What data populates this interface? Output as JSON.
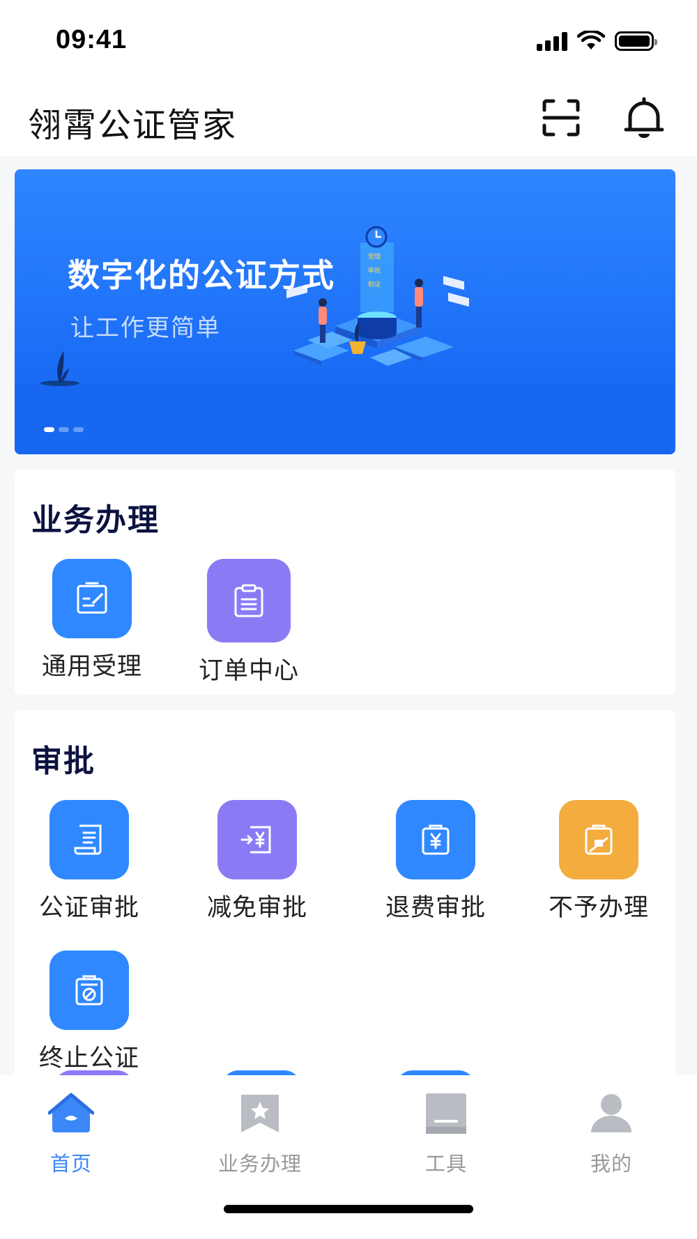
{
  "status_bar": {
    "time": "09:41"
  },
  "header": {
    "title": "翎霄公证管家"
  },
  "banner": {
    "title": "数字化的公证方式",
    "subtitle": "让工作更简单",
    "illustration_labels": [
      "受理",
      "审批",
      "制证"
    ],
    "slide_count": 3,
    "active_slide": 1
  },
  "business": {
    "title": "业务办理",
    "items": [
      {
        "label": "通用受理",
        "icon": "edit-document-icon",
        "color": "#2f88ff"
      },
      {
        "label": "订单中心",
        "icon": "clipboard-list-icon",
        "color": "#8a7bf5"
      }
    ]
  },
  "approval": {
    "title": "审批",
    "items": [
      {
        "label": "公证审批",
        "icon": "scroll-document-icon",
        "color": "#2f88ff"
      },
      {
        "label": "减免审批",
        "icon": "yuan-transfer-icon",
        "color": "#8a7bf5"
      },
      {
        "label": "退费审批",
        "icon": "yuan-bag-icon",
        "color": "#2f88ff"
      },
      {
        "label": "不予办理",
        "icon": "reject-clipboard-icon",
        "color": "#f4ac3e"
      },
      {
        "label": "终止公证",
        "icon": "forbidden-clipboard-icon",
        "color": "#2f88ff"
      }
    ]
  },
  "tab_bar": {
    "tabs": [
      {
        "label": "首页",
        "icon": "home-icon",
        "active": true
      },
      {
        "label": "业务办理",
        "icon": "star-bookmark-icon",
        "active": false
      },
      {
        "label": "工具",
        "icon": "toolbox-icon",
        "active": false
      },
      {
        "label": "我的",
        "icon": "user-icon",
        "active": false
      }
    ]
  },
  "colors": {
    "primary": "#2f88ff",
    "purple": "#8a7bf5",
    "orange": "#f4ac3e",
    "tab_active": "#3b87f7",
    "tab_inactive": "#999999"
  }
}
